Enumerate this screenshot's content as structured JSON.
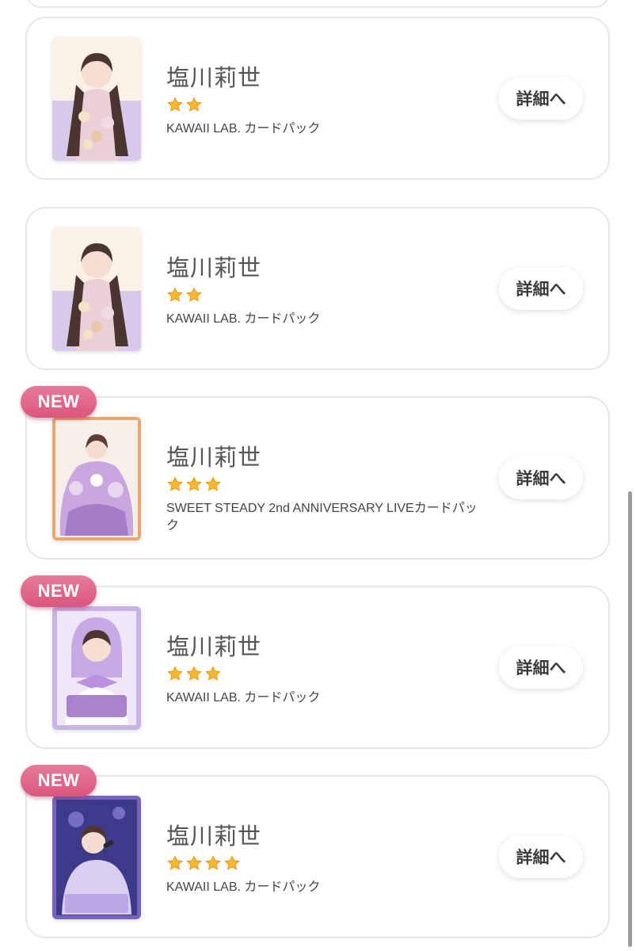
{
  "colors": {
    "star": "#f5b731",
    "badge": "#e06a8a",
    "text": "#555555",
    "border": "#e6e6ea"
  },
  "new_label": "NEW",
  "cards": [
    {
      "name": "塩川莉世",
      "stars": 2,
      "pack": "KAWAII LAB. カードパック",
      "button": "詳細へ",
      "is_new": false
    },
    {
      "name": "塩川莉世",
      "stars": 2,
      "pack": "KAWAII LAB. カードパック",
      "button": "詳細へ",
      "is_new": false
    },
    {
      "name": "塩川莉世",
      "stars": 3,
      "pack": "SWEET STEADY 2nd ANNIVERSARY LIVEカードパック",
      "button": "詳細へ",
      "is_new": true
    },
    {
      "name": "塩川莉世",
      "stars": 3,
      "pack": "KAWAII LAB. カードパック",
      "button": "詳細へ",
      "is_new": true
    },
    {
      "name": "塩川莉世",
      "stars": 4,
      "pack": "KAWAII LAB. カードパック",
      "button": "詳細へ",
      "is_new": true
    }
  ]
}
